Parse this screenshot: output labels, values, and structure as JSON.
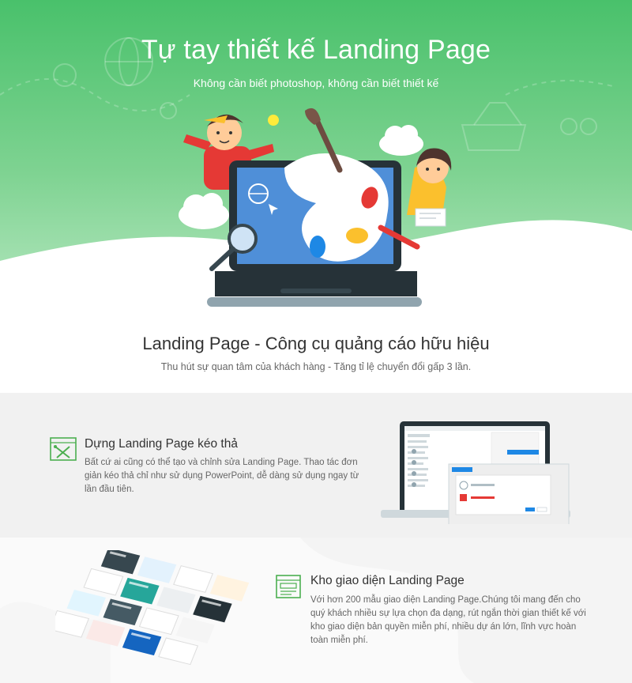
{
  "hero": {
    "title": "Tự tay thiết kế Landing Page",
    "subtitle": "Không cần biết photoshop, không cần biết thiết kế"
  },
  "intro": {
    "heading": "Landing Page - Công cụ quảng cáo hữu hiệu",
    "subheading": "Thu hút sự quan tâm của khách hàng - Tăng tỉ lệ chuyển đổi gấp 3 lần."
  },
  "features": [
    {
      "icon": "drag-drop-tools-icon",
      "title": "Dựng Landing Page kéo thả",
      "description": "Bất cứ ai cũng có thể tạo và chỉnh sửa Landing Page. Thao tác đơn giản kéo thả chỉ như sử dụng PowerPoint, dễ dàng sử dụng ngay từ lần đầu tiên."
    },
    {
      "icon": "template-layout-icon",
      "title": "Kho giao diện Landing Page",
      "description": "Với hơn 200 mẫu giao diện Landing Page.Chúng tôi mang đến cho quý khách nhiều sự lựa chọn đa dạng, rút ngắn thời gian thiết kế với kho giao diện bản quyền miễn phí, nhiều dự án lớn, lĩnh vực hoàn toàn miễn phí."
    }
  ],
  "colors": {
    "hero_green_top": "#4fc36f",
    "hero_green_bottom": "#a8e2b6",
    "accent_green": "#4caf50",
    "laptop_dark": "#263238"
  }
}
